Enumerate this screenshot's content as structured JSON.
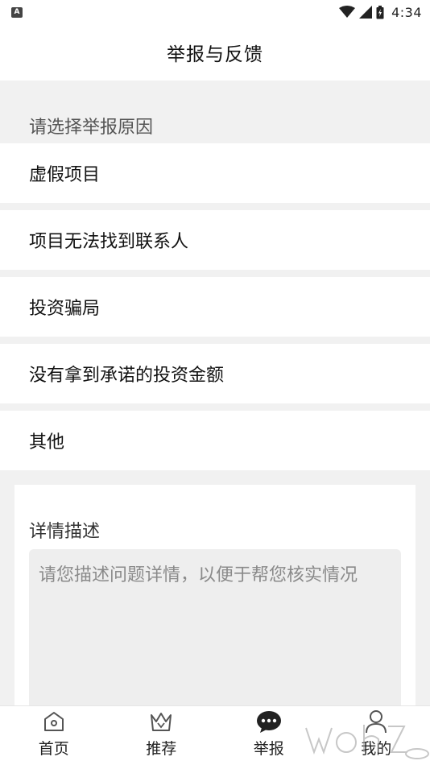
{
  "status_bar": {
    "notification_icon": "A",
    "time": "4:34"
  },
  "header": {
    "title": "举报与反馈"
  },
  "report": {
    "section_label": "请选择举报原因",
    "reasons": [
      {
        "label": "虚假项目"
      },
      {
        "label": "项目无法找到联系人"
      },
      {
        "label": "投资骗局"
      },
      {
        "label": "没有拿到承诺的投资金额"
      },
      {
        "label": "其他"
      }
    ]
  },
  "detail": {
    "title": "详情描述",
    "value": "",
    "placeholder": "请您描述问题详情，以便于帮您核实情况"
  },
  "tabs": [
    {
      "label": "首页",
      "icon": "home-icon"
    },
    {
      "label": "推荐",
      "icon": "crown-icon"
    },
    {
      "label": "举报",
      "icon": "chat-bubble-icon",
      "active": true
    },
    {
      "label": "我的",
      "icon": "user-icon"
    }
  ],
  "colors": {
    "background": "#f1f1f1",
    "surface": "#ffffff",
    "input_bg": "#eeeeee",
    "text_primary": "#111111",
    "text_secondary": "#555555"
  }
}
